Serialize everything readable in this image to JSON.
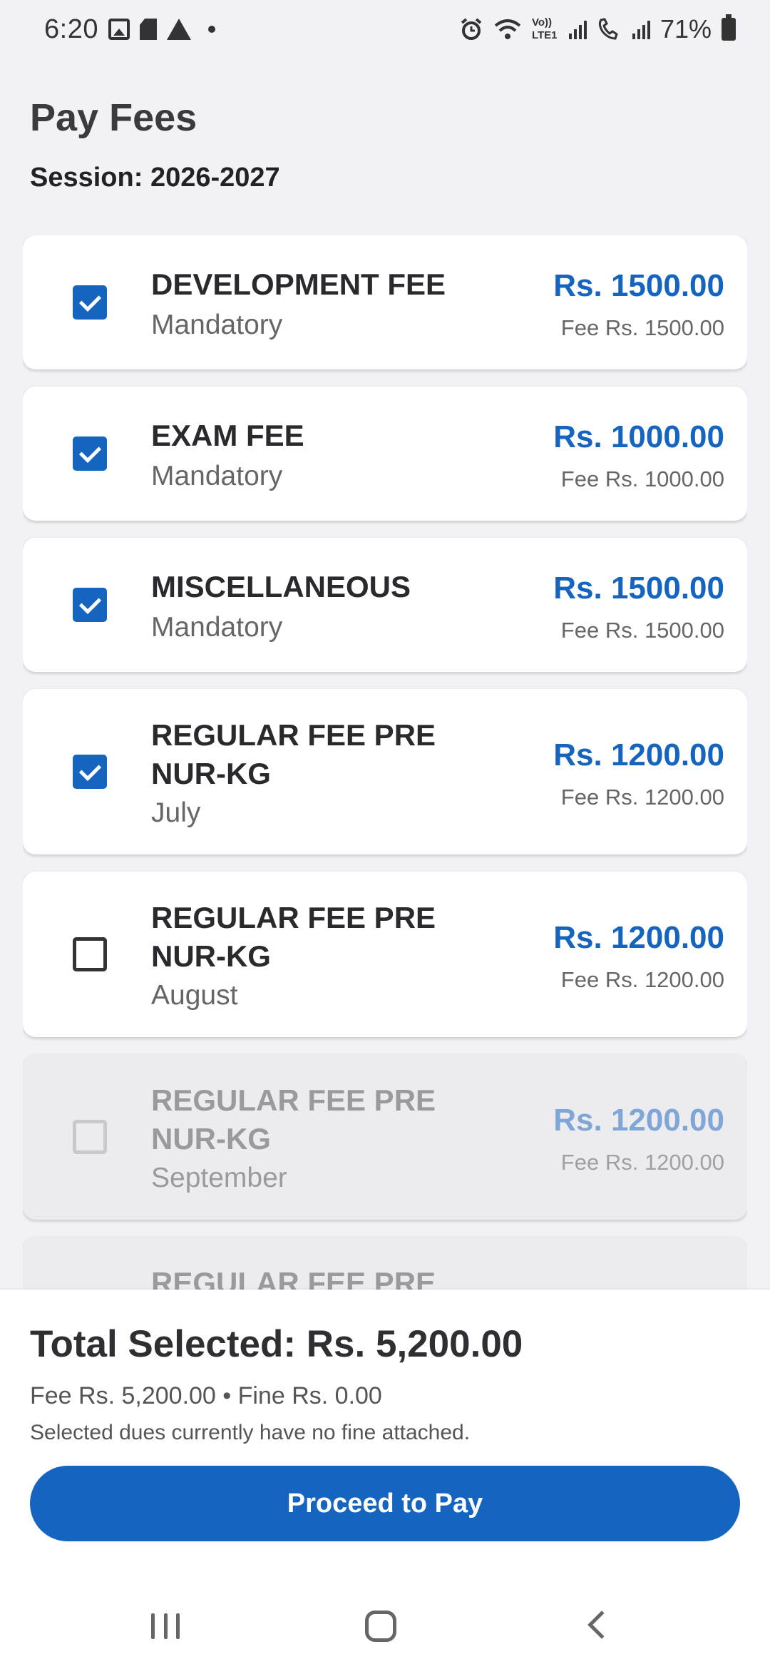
{
  "status_bar": {
    "time": "6:20",
    "network_label": "Vo)) LTE1",
    "battery_percent": "71%",
    "icons": [
      "image-icon",
      "sd-card-icon",
      "warning-icon",
      "dot-icon",
      "alarm-icon",
      "wifi-icon",
      "signal-icon",
      "wifi-calling-icon",
      "battery-icon"
    ]
  },
  "header": {
    "title": "Pay Fees",
    "session": "Session: 2026-2027"
  },
  "fees": [
    {
      "name": "DEVELOPMENT FEE",
      "sub": "Mandatory",
      "amount": "Rs. 1500.00",
      "base": "Fee Rs. 1500.00",
      "checked": true,
      "disabled": false
    },
    {
      "name": "EXAM FEE",
      "sub": "Mandatory",
      "amount": "Rs. 1000.00",
      "base": "Fee Rs. 1000.00",
      "checked": true,
      "disabled": false
    },
    {
      "name": "MISCELLANEOUS",
      "sub": "Mandatory",
      "amount": "Rs. 1500.00",
      "base": "Fee Rs. 1500.00",
      "checked": true,
      "disabled": false
    },
    {
      "name": "REGULAR FEE PRE NUR-KG",
      "sub": "July",
      "amount": "Rs. 1200.00",
      "base": "Fee Rs. 1200.00",
      "checked": true,
      "disabled": false
    },
    {
      "name": "REGULAR FEE PRE NUR-KG",
      "sub": "August",
      "amount": "Rs. 1200.00",
      "base": "Fee Rs. 1200.00",
      "checked": false,
      "disabled": false
    },
    {
      "name": "REGULAR FEE PRE NUR-KG",
      "sub": "September",
      "amount": "Rs. 1200.00",
      "base": "Fee Rs. 1200.00",
      "checked": false,
      "disabled": true
    },
    {
      "name": "REGULAR FEE PRE",
      "sub": "",
      "amount": "",
      "base": "",
      "checked": false,
      "disabled": true
    }
  ],
  "summary": {
    "total": "Total Selected: Rs. 5,200.00",
    "breakdown": "Fee Rs. 5,200.00 • Fine Rs. 0.00",
    "note": "Selected dues currently have no fine attached.",
    "pay_button": "Proceed to Pay"
  },
  "colors": {
    "accent": "#1565c0",
    "background": "#f2f2f6",
    "disabled_card": "#ececee"
  }
}
